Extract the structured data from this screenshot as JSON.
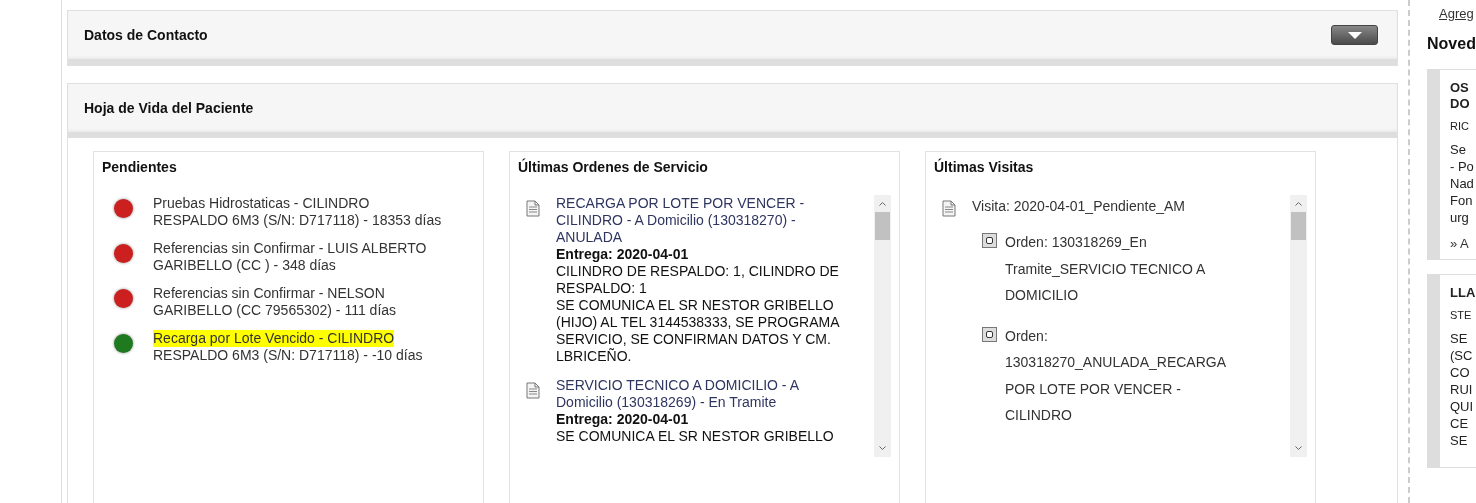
{
  "contact_panel": {
    "title": "Datos de Contacto"
  },
  "history_panel": {
    "title": "Hoja de Vida del Paciente",
    "pending": {
      "title": "Pendientes",
      "items": [
        {
          "text": "Pruebas Hidrostaticas - CILINDRO",
          "text_2": "RESPALDO 6M3 (S/N: D717118) - 18353 días",
          "color": "#cc1f1f",
          "highlighted": false
        },
        {
          "text": "Referencias sin Confirmar - LUIS ALBERTO",
          "text_2": "GARIBELLO (CC ) - 348 días",
          "color": "#cc1f1f",
          "highlighted": false
        },
        {
          "text": "Referencias sin Confirmar - NELSON",
          "text_2": "GARIBELLO (CC 79565302) - 111 días",
          "color": "#cc1f1f",
          "highlighted": false
        },
        {
          "text": "Recarga por Lote Vencido - CILINDRO",
          "text_2": "RESPALDO 6M3 (S/N: D717118) - -10 días",
          "color": "#1f7a1f",
          "highlighted": true
        }
      ]
    },
    "orders": {
      "title": "Últimas Ordenes de Servicio",
      "items": [
        {
          "title": "RECARGA POR LOTE POR VENCER - CILINDRO - A Domicilio (130318270) - ANULADA",
          "delivery": "Entrega: 2020-04-01",
          "details": [
            "CILINDRO DE RESPALDO: 1, CILINDRO DE RESPALDO: 1",
            "SE COMUNICA EL SR NESTOR GRIBELLO (HIJO) AL TEL 3144538333, SE PROGRAMA SERVICIO, SE CONFIRMAN DATOS Y CM. LBRICEÑO."
          ]
        },
        {
          "title": "SERVICIO TECNICO A DOMICILIO - A Domicilio (130318269) - En Tramite",
          "delivery": "Entrega: 2020-04-01",
          "details": [
            "SE COMUNICA EL SR NESTOR GRIBELLO"
          ]
        }
      ]
    },
    "visits": {
      "title": "Últimas Visitas",
      "items": [
        {
          "text": "Visita: 2020-04-01_Pendiente_AM",
          "children": [
            {
              "text": "Orden: 130318269_En Tramite_SERVICIO TECNICO A DOMICILIO"
            },
            {
              "text": "Orden: 130318270_ANULADA_RECARGA POR LOTE POR VENCER - CILINDRO"
            }
          ]
        }
      ]
    }
  },
  "sidebar": {
    "link": "Agreg",
    "title": "Noved",
    "cards": [
      {
        "title": [
          "OS",
          "DO"
        ],
        "author": "RIC",
        "body": [
          "Se",
          "- Po",
          "Nad",
          "Fon",
          "urg"
        ],
        "link": "» A"
      },
      {
        "title": [
          "LLA"
        ],
        "author": "STE",
        "body": [
          "SE",
          "(SC",
          "CO",
          "RUI",
          "QUI",
          "CE",
          "SE"
        ]
      }
    ]
  }
}
